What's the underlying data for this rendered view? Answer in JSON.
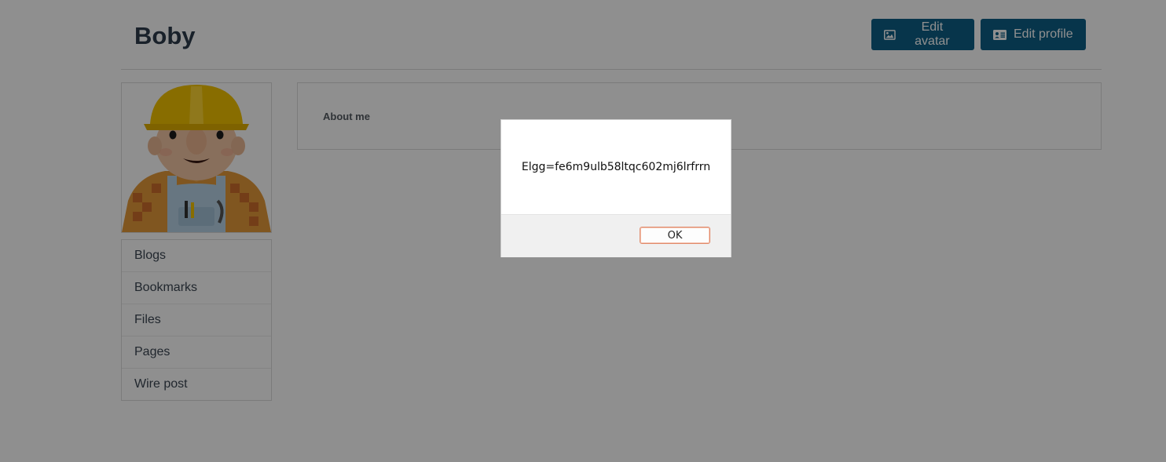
{
  "profile": {
    "name": "Boby",
    "edit_avatar_label": "Edit avatar",
    "edit_profile_label": "Edit profile",
    "avatar_icon": "bob-the-builder-avatar",
    "about_label": "About me"
  },
  "owner_menu": {
    "items": [
      {
        "label": "Blogs"
      },
      {
        "label": "Bookmarks"
      },
      {
        "label": "Files"
      },
      {
        "label": "Pages"
      },
      {
        "label": "Wire post"
      }
    ]
  },
  "alert": {
    "message": "Elgg=fe6m9ulb58ltqc602mj6lrfrrn",
    "ok_label": "OK"
  },
  "colors": {
    "primary_button": "#0e5f86",
    "overlay": "rgba(0,0,0,0.44)",
    "title": "#2d3c4c"
  },
  "icons": {
    "edit_avatar": "image-icon",
    "edit_profile": "id-card-icon"
  }
}
